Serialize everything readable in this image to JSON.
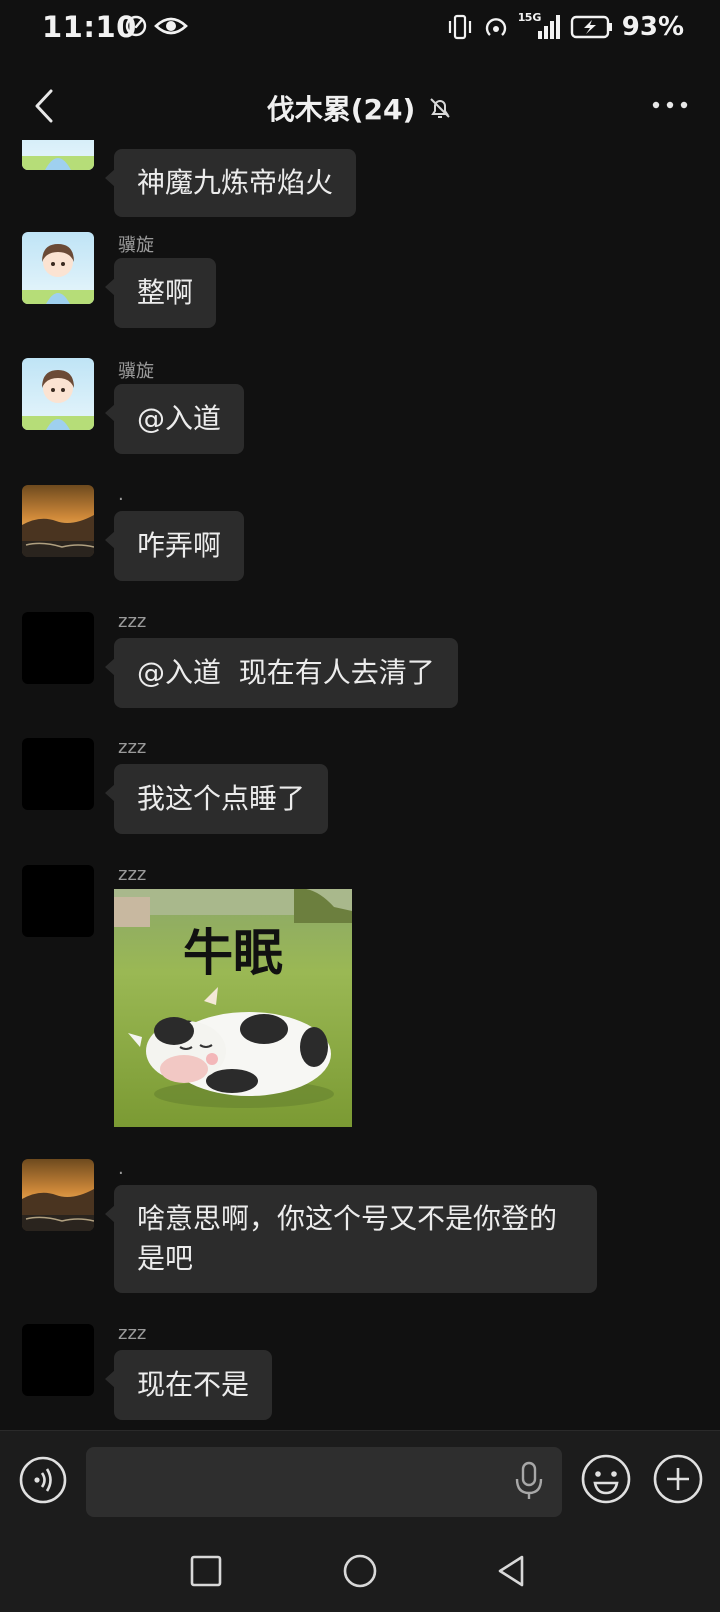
{
  "status_bar": {
    "time": "11:10",
    "network": "5G",
    "sim": "1",
    "battery": "93%"
  },
  "header": {
    "title": "伐木累(24)"
  },
  "messages": [
    {
      "sender": "",
      "text": "神魔九炼帝焰火",
      "avatar": "boy-cartoon"
    },
    {
      "sender": "骥旋",
      "text": "整啊",
      "avatar": "boy-cartoon"
    },
    {
      "sender": "骥旋",
      "text": "@入道",
      "avatar": "boy-cartoon"
    },
    {
      "sender": ".",
      "text": "咋弄啊",
      "avatar": "sunset-coast"
    },
    {
      "sender": "zzz",
      "text": "@入道  现在有人去清了",
      "avatar": "black"
    },
    {
      "sender": "zzz",
      "text": "我这个点睡了",
      "avatar": "black"
    },
    {
      "sender": "zzz",
      "sticker_text": "牛眠",
      "avatar": "black"
    },
    {
      "sender": ".",
      "text_line1": "啥意思啊，你这个号又不是你登的",
      "text_line2": "是吧",
      "avatar": "sunset-coast"
    },
    {
      "sender": "zzz",
      "text": "现在不是",
      "avatar": "black"
    }
  ],
  "input": {
    "placeholder": ""
  },
  "icons": {
    "back": "back-chevron-icon",
    "mute": "bell-muted-icon",
    "more": "more-dots-icon",
    "voice": "voice-icon",
    "mic": "mic-icon",
    "emoji": "emoji-icon",
    "plus": "plus-icon"
  },
  "colors": {
    "background": "#111111",
    "bubble": "#2c2c2c",
    "text": "#ececec",
    "sender": "#9a9a9a"
  }
}
